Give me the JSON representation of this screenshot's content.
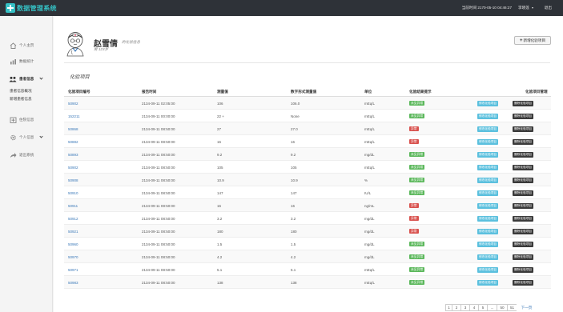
{
  "brand": {
    "title": "数据管理系统"
  },
  "topbar": {
    "time": "当前时间 2170-05-10 04:46:27",
    "user": "李晓莲",
    "logout": "退出"
  },
  "sidebar": {
    "items": [
      {
        "label": "个人主页",
        "icon": "home-icon"
      },
      {
        "label": "数据统计",
        "icon": "chart-icon"
      },
      {
        "label": "患者信息",
        "icon": "users-icon"
      },
      {
        "label": "住院信息",
        "icon": "hospital-icon"
      },
      {
        "label": "个人信息",
        "icon": "gear-icon"
      },
      {
        "label": "退出系统",
        "icon": "share-icon"
      }
    ],
    "sub_items": [
      {
        "label": "患者信息概况"
      },
      {
        "label": "新增患者信息"
      }
    ]
  },
  "profile": {
    "name": "赵雪倩",
    "role": "的化验信息",
    "age": "男 123岁"
  },
  "actions": {
    "add_label": "新增化验项目"
  },
  "section": {
    "title": "化验项目"
  },
  "table": {
    "headers": [
      "化验项目编号",
      "报告时间",
      "测量值",
      "数字形式测量值",
      "单位",
      "化验结果提示",
      "化验项目管理"
    ],
    "edit_label": "修改化验项目",
    "delete_label": "删除化验项目",
    "rows": [
      {
        "id": "50902",
        "time": "2134-09-11 02:05:00",
        "value": "106",
        "numeric": "106.0",
        "unit": "mEq/L",
        "flag": "未见异常",
        "flag_type": "ok"
      },
      {
        "id": "152211",
        "time": "2134-09-11 00:00:00",
        "value": "22 +",
        "numeric": "None",
        "unit": "mEq/L",
        "flag": "未见异常",
        "flag_type": "ok"
      },
      {
        "id": "50868",
        "time": "2134-09-11 08:50:00",
        "value": "27",
        "numeric": "27.0",
        "unit": "mEq/L",
        "flag": "异常",
        "flag_type": "bad"
      },
      {
        "id": "50882",
        "time": "2134-09-11 08:50:00",
        "value": "16",
        "numeric": "16",
        "unit": "mEq/L",
        "flag": "异常",
        "flag_type": "bad"
      },
      {
        "id": "50893",
        "time": "2134-09-11 08:50:00",
        "value": "9.2",
        "numeric": "9.2",
        "unit": "mg/dL",
        "flag": "未见异常",
        "flag_type": "ok"
      },
      {
        "id": "50902",
        "time": "2134-09-11 08:50:00",
        "value": "105",
        "numeric": "105",
        "unit": "mEq/L",
        "flag": "未见异常",
        "flag_type": "ok"
      },
      {
        "id": "50908",
        "time": "2134-09-11 08:50:00",
        "value": "10.9",
        "numeric": "10.9",
        "unit": "%",
        "flag": "未见异常",
        "flag_type": "ok"
      },
      {
        "id": "50910",
        "time": "2134-09-11 08:50:00",
        "value": "147",
        "numeric": "147",
        "unit": "IU/L",
        "flag": "未见异常",
        "flag_type": "ok"
      },
      {
        "id": "50911",
        "time": "2134-09-11 08:50:00",
        "value": "16",
        "numeric": "16",
        "unit": "ng/mL",
        "flag": "异常",
        "flag_type": "bad"
      },
      {
        "id": "50912",
        "time": "2134-09-11 08:50:00",
        "value": "3.2",
        "numeric": "3.2",
        "unit": "mg/dL",
        "flag": "异常",
        "flag_type": "bad"
      },
      {
        "id": "50921",
        "time": "2134-09-11 08:50:00",
        "value": "180",
        "numeric": "180",
        "unit": "mg/dL",
        "flag": "异常",
        "flag_type": "bad"
      },
      {
        "id": "50960",
        "time": "2134-09-11 08:50:00",
        "value": "1.5",
        "numeric": "1.5",
        "unit": "mg/dL",
        "flag": "未见异常",
        "flag_type": "ok"
      },
      {
        "id": "50970",
        "time": "2134-09-11 08:50:00",
        "value": "4.2",
        "numeric": "4.2",
        "unit": "mg/dL",
        "flag": "未见异常",
        "flag_type": "ok"
      },
      {
        "id": "50971",
        "time": "2134-09-11 08:50:00",
        "value": "5.1",
        "numeric": "5.1",
        "unit": "mEq/L",
        "flag": "未见异常",
        "flag_type": "ok"
      },
      {
        "id": "50983",
        "time": "2134-09-11 08:50:00",
        "value": "138",
        "numeric": "138",
        "unit": "mEq/L",
        "flag": "未见异常",
        "flag_type": "ok"
      }
    ]
  },
  "pagination": {
    "pages": [
      "1",
      "2",
      "3",
      "4",
      "5",
      "...",
      "50",
      "51"
    ],
    "next": "下一页"
  },
  "colors": {
    "topbar": "#2e3238",
    "brand": "#35c0c4",
    "ok": "#5cb85c",
    "bad": "#d9534f",
    "link": "#3a78b8"
  }
}
